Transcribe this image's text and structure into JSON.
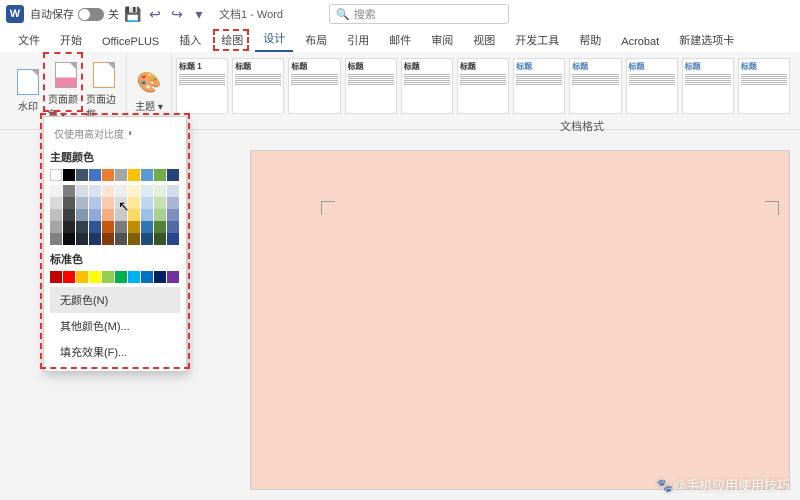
{
  "titlebar": {
    "autosave_label": "自动保存",
    "autosave_state": "关",
    "doc_title": "文档1 - Word",
    "search_placeholder": "搜索"
  },
  "tabs": {
    "items": [
      "文件",
      "开始",
      "OfficePLUS",
      "插入",
      "绘图",
      "设计",
      "布局",
      "引用",
      "邮件",
      "审阅",
      "视图",
      "开发工具",
      "帮助",
      "Acrobat",
      "新建选项卡"
    ],
    "active_index": 5
  },
  "ribbon": {
    "buttons": {
      "watermark": "水印",
      "page_color": "页面颜色",
      "page_border": "页面边框",
      "themes": "主题"
    },
    "group_label": "文档格式",
    "style_heading": "标题",
    "style_title": "标题 1"
  },
  "popup": {
    "contrast_label": "仅使用高对比度",
    "theme_colors_label": "主题颜色",
    "standard_colors_label": "标准色",
    "no_color": "无颜色(N)",
    "more_colors": "其他颜色(M)...",
    "fill_effects": "填充效果(F)...",
    "theme_palette_row1": [
      "#ffffff",
      "#000000",
      "#44546a",
      "#4472c4",
      "#ed7d31",
      "#a5a5a5",
      "#ffc000",
      "#5b9bd5",
      "#70ad47",
      "#264478"
    ],
    "theme_shades": [
      [
        "#f2f2f2",
        "#7f7f7f",
        "#d6dce5",
        "#d9e1f2",
        "#fce4d6",
        "#ededed",
        "#fff2cc",
        "#ddebf7",
        "#e2efda",
        "#d4dbea"
      ],
      [
        "#d9d9d9",
        "#595959",
        "#adb9ca",
        "#b4c6e7",
        "#f8cbad",
        "#dbdbdb",
        "#ffe699",
        "#bdd7ee",
        "#c6e0b4",
        "#a9b5d3"
      ],
      [
        "#bfbfbf",
        "#404040",
        "#8497b0",
        "#8ea9db",
        "#f4b084",
        "#c9c9c9",
        "#ffd966",
        "#9bc2e6",
        "#a9d08e",
        "#7e8fbc"
      ],
      [
        "#a6a6a6",
        "#262626",
        "#333f4f",
        "#305496",
        "#c65911",
        "#7b7b7b",
        "#bf8f00",
        "#2f75b5",
        "#548235",
        "#536aa5"
      ],
      [
        "#808080",
        "#0d0d0d",
        "#222b35",
        "#203764",
        "#833c0c",
        "#525252",
        "#806000",
        "#1f4e78",
        "#375623",
        "#28448e"
      ]
    ],
    "standard_palette": [
      "#c00000",
      "#ff0000",
      "#ffc000",
      "#ffff00",
      "#92d050",
      "#00b050",
      "#00b0f0",
      "#0070c0",
      "#002060",
      "#7030a0"
    ]
  },
  "document": {
    "page_bg": "#f8d7c8"
  },
  "watermark_text": "@手机应用使用技巧"
}
